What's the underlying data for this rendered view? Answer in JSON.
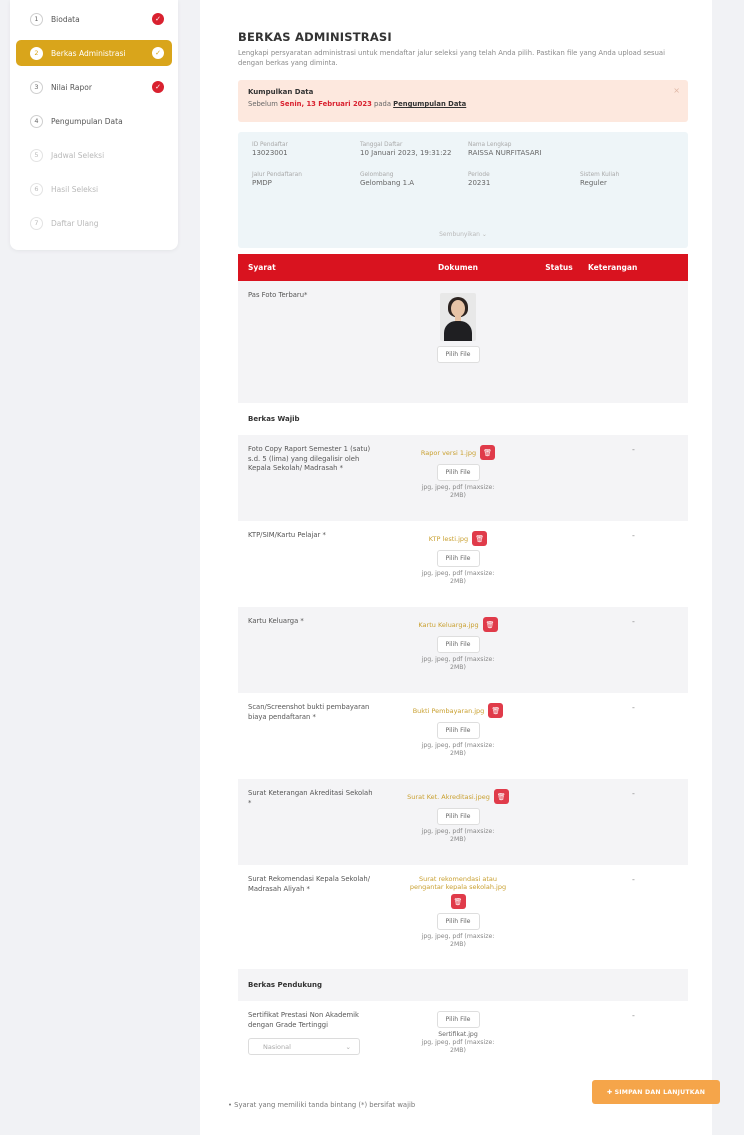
{
  "sidebar": {
    "steps": [
      {
        "num": "1",
        "label": "Biodata",
        "status": "done"
      },
      {
        "num": "2",
        "label": "Berkas Administrasi",
        "status": "active"
      },
      {
        "num": "3",
        "label": "Nilai Rapor",
        "status": "done"
      },
      {
        "num": "4",
        "label": "Pengumpulan Data",
        "status": "todo"
      },
      {
        "num": "5",
        "label": "Jadwal Seleksi",
        "status": "muted"
      },
      {
        "num": "6",
        "label": "Hasil Seleksi",
        "status": "muted"
      },
      {
        "num": "7",
        "label": "Daftar Ulang",
        "status": "muted"
      }
    ]
  },
  "main": {
    "title": "BERKAS ADMINISTRASI",
    "description": "Lengkapi persyaratan administrasi untuk mendaftar jalur seleksi yang telah Anda pilih. Pastikan file yang Anda upload sesuai dengan berkas yang diminta.",
    "alert": {
      "heading": "Kumpulkan Data",
      "prefix": "Sebelum ",
      "deadline": "Senin, 13 Februari 2023",
      "middle": " pada ",
      "link": "Pengumpulan Data",
      "close": "×"
    },
    "info": [
      {
        "label": "ID Pendaftar",
        "value": "13023001"
      },
      {
        "label": "Tanggal Daftar",
        "value": "10 Januari 2023, 19:31:22"
      },
      {
        "label": "Nama Lengkap",
        "value": "RAISSA NURFITASARI"
      },
      {
        "label": "",
        "value": ""
      },
      {
        "label": "Jalur Pendaftaran",
        "value": "PMDP"
      },
      {
        "label": "Gelombang",
        "value": "Gelombang 1.A"
      },
      {
        "label": "Periode",
        "value": "20231"
      },
      {
        "label": "Sistem Kuliah",
        "value": "Reguler"
      }
    ],
    "info_more": "Sembunyikan ⌄",
    "table": {
      "headers": [
        "Syarat",
        "Dokumen",
        "Status",
        "Keterangan"
      ],
      "pas_foto": {
        "label": "Pas Foto Terbaru*",
        "button": "Pilih File"
      },
      "section_wajib": "Berkas Wajib",
      "section_pendukung": "Berkas Pendukung",
      "rows": [
        {
          "req": "Foto Copy Raport Semester 1 (satu) s.d. 5 (lima) yang dilegalisir oleh Kepala Sekolah/ Madrasah *",
          "file": "Rapor versi 1.jpg",
          "button": "Pilih File",
          "hint": "jpg, jpeg, pdf (maxsize: 2MB)",
          "ket": "-"
        },
        {
          "req": "KTP/SIM/Kartu Pelajar *",
          "file": "KTP lesti.jpg",
          "button": "Pilih File",
          "hint": "jpg, jpeg, pdf (maxsize: 2MB)",
          "ket": "-"
        },
        {
          "req": "Kartu Keluarga *",
          "file": "Kartu Keluarga.jpg",
          "button": "Pilih File",
          "hint": "jpg, jpeg, pdf (maxsize: 2MB)",
          "ket": "-"
        },
        {
          "req": "Scan/Screenshot bukti pembayaran biaya pendaftaran *",
          "file": "Bukti Pembayaran.jpg",
          "button": "Pilih File",
          "hint": "jpg, jpeg, pdf (maxsize: 2MB)",
          "ket": "-"
        },
        {
          "req": "Surat Keterangan Akreditasi Sekolah *",
          "file": "Surat Ket. Akreditasi.jpeg",
          "button": "Pilih File",
          "hint": "jpg, jpeg, pdf (maxsize: 2MB)",
          "ket": "-"
        },
        {
          "req": "Surat Rekomendasi Kepala Sekolah/ Madrasah Aliyah *",
          "file": "Surat rekomendasi atau pengantar kepala sekolah.jpg",
          "button": "Pilih File",
          "hint": "jpg, jpeg, pdf (maxsize: 2MB)",
          "ket": "-"
        }
      ],
      "support_row": {
        "req": "Sertifikat Prestasi Non Akademik dengan Grade Tertinggi",
        "select_value": "Nasional",
        "button": "Pilih File",
        "file": "Sertifikat.jpg",
        "hint": "jpg, jpeg, pdf (maxsize: 2MB)",
        "ket": "-"
      }
    },
    "note": "Syarat yang memiliki tanda bintang (*) bersifat wajib",
    "submit": "✚ SIMPAN DAN LANJUTKAN"
  },
  "colors": {
    "accent": "#d9a51b",
    "danger": "#d9131f",
    "orange": "#f5a54a"
  }
}
